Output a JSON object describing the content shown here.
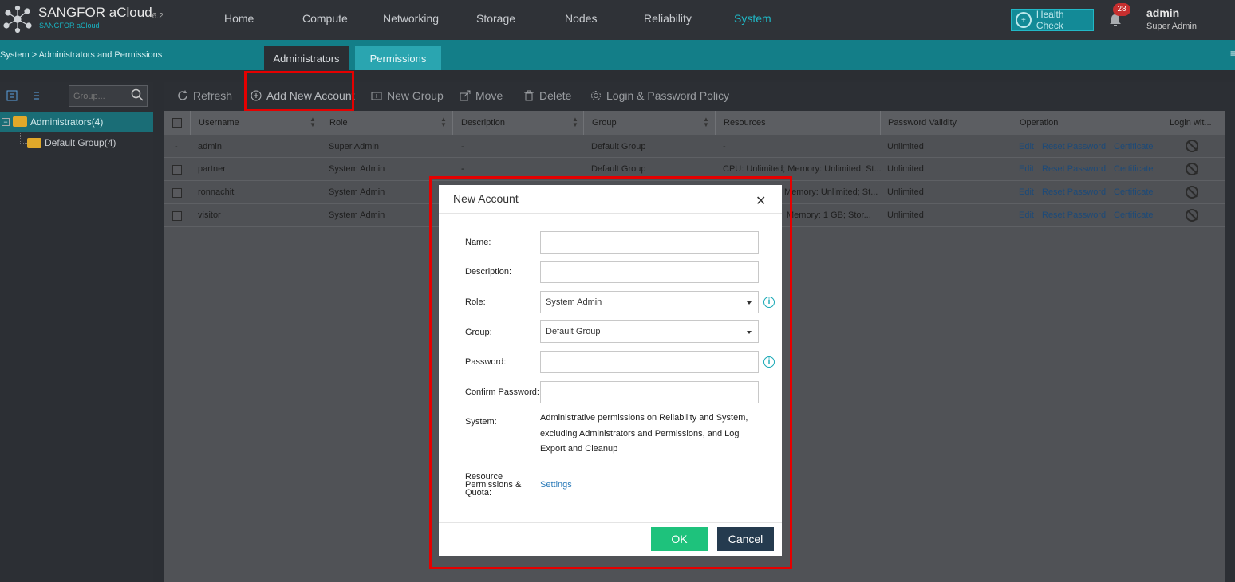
{
  "header": {
    "brand": "SANGFOR aCloud",
    "version": "6.2",
    "brand_sub": "SANGFOR aCloud",
    "nav": [
      "Home",
      "Compute",
      "Networking",
      "Storage",
      "Nodes",
      "Reliability",
      "System"
    ],
    "active_nav": "System",
    "health_check": "Health Check",
    "notifications": "28",
    "user_name": "admin",
    "user_role": "Super Admin"
  },
  "breadcrumb": "System > Administrators and Permissions",
  "tabs": {
    "administrators": "Administrators",
    "permissions": "Permissions"
  },
  "left": {
    "search_placeholder": "Group...",
    "root": "Administrators(4)",
    "child": "Default Group(4)"
  },
  "toolbar": {
    "refresh": "Refresh",
    "add": "Add New Account",
    "new_group": "New Group",
    "move": "Move",
    "delete": "Delete",
    "policy": "Login & Password Policy"
  },
  "table": {
    "headers": {
      "username": "Username",
      "role": "Role",
      "description": "Description",
      "group": "Group",
      "resources": "Resources",
      "validity": "Password Validity",
      "operation": "Operation",
      "login": "Login wit..."
    },
    "ops": {
      "edit": "Edit",
      "reset": "Reset Password",
      "cert": "Certificate"
    },
    "rows": [
      {
        "sel": "-",
        "username": "admin",
        "role": "Super Admin",
        "description": "-",
        "group": "Default Group",
        "resources": "-",
        "validity": "Unlimited"
      },
      {
        "sel": "",
        "username": "partner",
        "role": "System Admin",
        "description": "-",
        "group": "Default Group",
        "resources": "CPU: Unlimited; Memory: Unlimited; St...",
        "validity": "Unlimited"
      },
      {
        "sel": "",
        "username": "ronnachit",
        "role": "System Admin",
        "description": "",
        "group": "",
        "resources": "Memory: Unlimited; St...",
        "validity": "Unlimited"
      },
      {
        "sel": "",
        "username": "visitor",
        "role": "System Admin",
        "description": "",
        "group": "",
        "resources": "Memory: 1 GB; Stor...",
        "validity": "Unlimited"
      }
    ]
  },
  "modal": {
    "title": "New Account",
    "labels": {
      "name": "Name:",
      "description": "Description:",
      "role": "Role:",
      "group": "Group:",
      "password": "Password:",
      "confirm": "Confirm Password:",
      "system": "System:",
      "resource": "Resource Permissions & Quota:"
    },
    "role_value": "System Admin",
    "group_value": "Default Group",
    "system_text": "Administrative permissions on Reliability and System, excluding Administrators and Permissions, and Log Export and Cleanup",
    "settings": "Settings",
    "ok": "OK",
    "cancel": "Cancel"
  },
  "colors": {
    "accent": "#137e88",
    "ok": "#1ec27c",
    "cancel": "#253b4f",
    "highlight": "#e50000"
  }
}
